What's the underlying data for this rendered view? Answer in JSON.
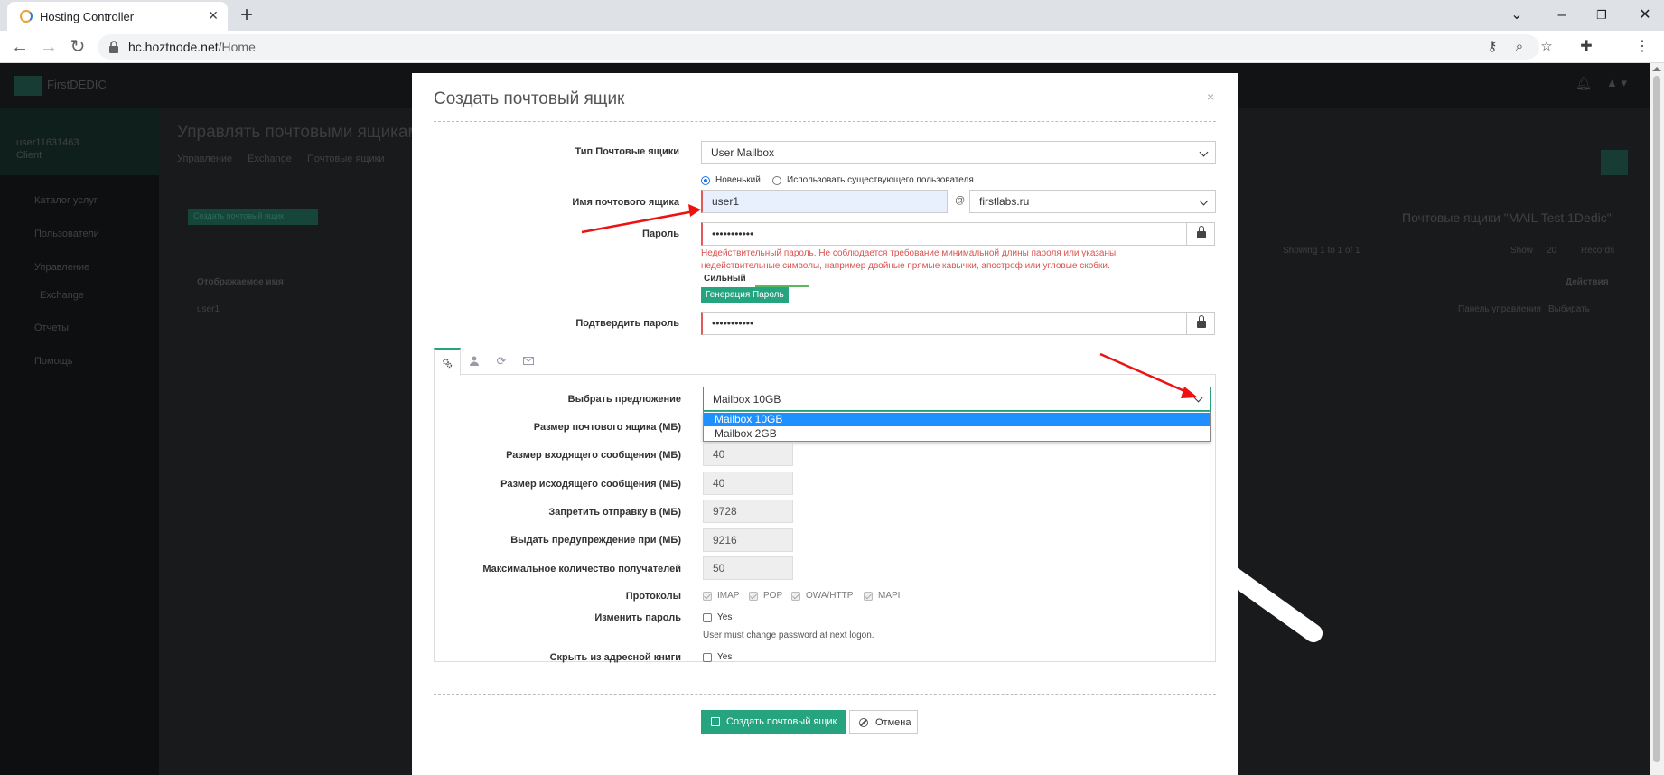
{
  "browser": {
    "tab_title": "Hosting Controller",
    "url_host": "hc.hoztnode.net",
    "url_path": "/Home"
  },
  "background": {
    "brand": "FirstDEDIC",
    "user_name": "user11631463",
    "user_role": "Client",
    "page_title": "Управлять почтовыми ящиками",
    "breadcrumbs": [
      "Управление",
      "Exchange",
      "Почтовые ящики"
    ],
    "menu": [
      "Каталог услуг",
      "Пользователи",
      "Управление",
      "Exchange",
      "Отчеты",
      "Помощь"
    ],
    "create_btn": "Создать почтовый ящик",
    "table_heading": "Почтовые ящики \"MAIL Test 1Dedic\"",
    "showing": "Showing 1 to 1 of 1",
    "show_label": "Show",
    "show_count": "20",
    "records_label": "Records",
    "col_display_name": "Отображаемое имя",
    "col_actions": "Действия",
    "row_name": "user1",
    "row_panel": "Панель управления",
    "row_select": "Выбирать"
  },
  "modal": {
    "title": "Создать почтовый ящик",
    "close": "×",
    "mailbox_type": {
      "label": "Тип Почтовые ящики",
      "value": "User Mailbox"
    },
    "user_mode": {
      "new": "Новенький",
      "existing": "Использовать существующего пользователя"
    },
    "mailbox_name": {
      "label": "Имя почтового ящика",
      "value": "user1",
      "at": "@",
      "domain": "firstlabs.ru"
    },
    "password": {
      "label": "Пароль",
      "value": "•••••••••••"
    },
    "password_error": "Недействительный пароль. Не соблюдается требование минимальной длины пароля или указаны недействительные символы, например двойные прямые кавычки, апостроф или угловые скобки.",
    "strength": "Сильный",
    "generate_btn": "Генерация Пароль",
    "confirm_password": {
      "label": "Подтвердить пароль",
      "value": "•••••••••••"
    },
    "offer": {
      "label": "Выбрать предложение",
      "value": "Mailbox 10GB",
      "options": [
        "Mailbox 10GB",
        "Mailbox 2GB"
      ]
    },
    "fields": [
      {
        "label": "Размер почтового ящика (МБ)",
        "value": ""
      },
      {
        "label": "Размер входящего сообщения (МБ)",
        "value": "40"
      },
      {
        "label": "Размер исходящего сообщения (МБ)",
        "value": "40"
      },
      {
        "label": "Запретить отправку в (МБ)",
        "value": "9728"
      },
      {
        "label": "Выдать предупреждение при (МБ)",
        "value": "9216"
      },
      {
        "label": "Максимальное количество получателей",
        "value": "50"
      }
    ],
    "protocols": {
      "label": "Протоколы",
      "items": [
        "IMAP",
        "POP",
        "OWA/HTTP",
        "MAPI"
      ]
    },
    "change_password": {
      "label": "Изменить пароль",
      "yes": "Yes",
      "hint": "User must change password at next logon."
    },
    "hide_from_book": {
      "label": "Скрыть из адресной книги",
      "yes": "Yes"
    },
    "submit_btn": "Создать почтовый ящик",
    "cancel_btn": "Отмена"
  },
  "colors": {
    "accent": "#26a37f",
    "error": "#d9534f",
    "annotation": "#ee1111",
    "selected_option": "#1e90ff"
  }
}
